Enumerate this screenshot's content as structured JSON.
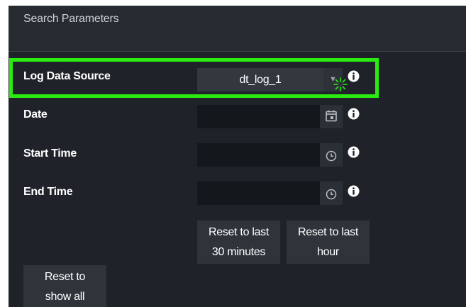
{
  "panel": {
    "title": "Search Parameters"
  },
  "log_data_source": {
    "label": "Log Data Source",
    "selected_value": "dt_log_1"
  },
  "date": {
    "label": "Date",
    "value": ""
  },
  "start_time": {
    "label": "Start Time",
    "value": ""
  },
  "end_time": {
    "label": "End Time",
    "value": ""
  },
  "buttons": {
    "reset_30_line1": "Reset to last",
    "reset_30_line2": "30 minutes",
    "reset_hour_line1": "Reset to last",
    "reset_hour_line2": "hour",
    "reset_all_line1": "Reset to",
    "reset_all_line2": "show all"
  },
  "icons": {
    "dropdown": "chevron-down-icon",
    "calendar": "calendar-icon",
    "clock": "clock-icon",
    "info": "info-icon",
    "click_indicator": "click-spark-icon"
  },
  "colors": {
    "panel_background": "#1f2329",
    "highlight": "#2bea12",
    "input_background": "#14171b",
    "button_background": "#2f343b",
    "text": "#ffffff"
  }
}
